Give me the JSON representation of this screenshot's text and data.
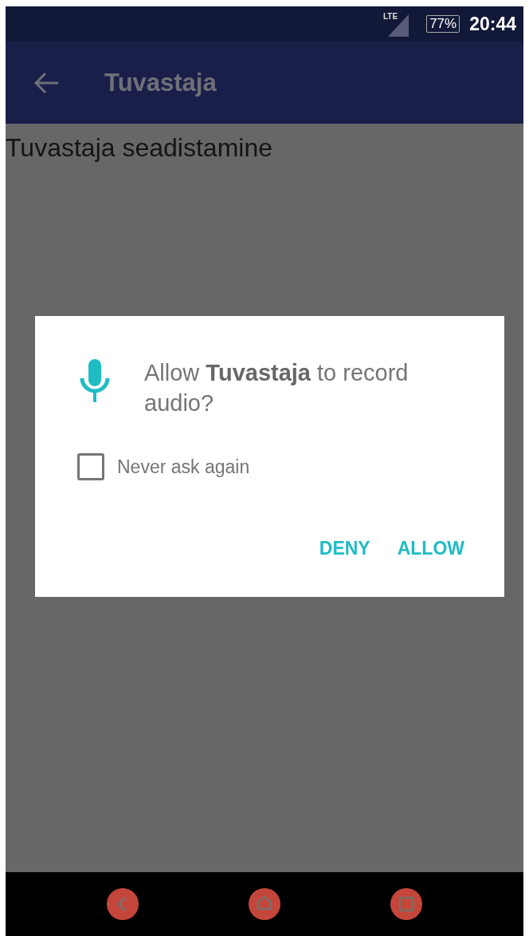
{
  "status_bar": {
    "network": "LTE",
    "battery": "77%",
    "time": "20:44"
  },
  "app_bar": {
    "title": "Tuvastaja"
  },
  "content": {
    "heading": "Tuvastaja seadistamine"
  },
  "dialog": {
    "message": "Allow **Tuvastaja** to record audio?",
    "checkbox": {
      "label": "Never ask again",
      "checked": false
    },
    "buttons": [
      {
        "label": "DENY"
      },
      {
        "label": "ALLOW"
      }
    ]
  }
}
